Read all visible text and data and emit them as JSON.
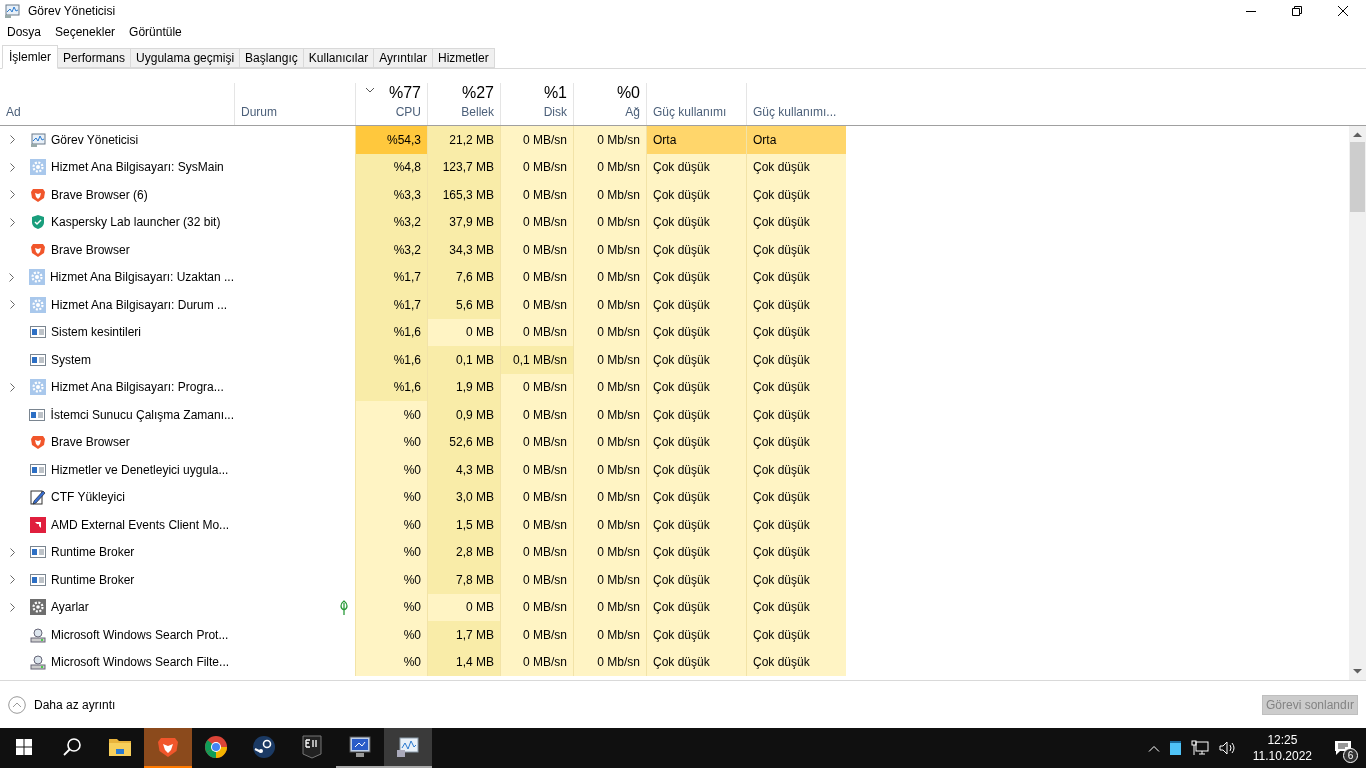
{
  "window": {
    "title": "Görev Yöneticisi"
  },
  "menu": [
    "Dosya",
    "Seçenekler",
    "Görüntüle"
  ],
  "tabs": [
    {
      "label": "İşlemler",
      "selected": true
    },
    {
      "label": "Performans",
      "selected": false
    },
    {
      "label": "Uygulama geçmişi",
      "selected": false
    },
    {
      "label": "Başlangıç",
      "selected": false
    },
    {
      "label": "Kullanıcılar",
      "selected": false
    },
    {
      "label": "Ayrıntılar",
      "selected": false
    },
    {
      "label": "Hizmetler",
      "selected": false
    }
  ],
  "columns": [
    {
      "label": "Ad",
      "sorted": false
    },
    {
      "label": "Durum",
      "sorted": false
    },
    {
      "label": "CPU",
      "total": "%77",
      "sorted": true
    },
    {
      "label": "Bellek",
      "total": "%27",
      "sorted": false
    },
    {
      "label": "Disk",
      "total": "%1",
      "sorted": false
    },
    {
      "label": "Ağ",
      "total": "%0",
      "sorted": false
    },
    {
      "label": "Güç kullanımı",
      "sorted": false
    },
    {
      "label": "Güç kullanımı...",
      "sorted": false
    }
  ],
  "rows": [
    {
      "name": "Görev Yöneticisi",
      "kind": "taskmgr",
      "expandable": true,
      "eco": false,
      "cells": [
        {
          "value": "%54,3",
          "color": "#ffc83d"
        },
        {
          "value": "21,2 MB",
          "color": "#f9eca8"
        },
        {
          "value": "0 MB/sn",
          "color": "#fff4c4"
        },
        {
          "value": "0 Mb/sn",
          "color": "#fff4c4"
        },
        {
          "value": "Orta",
          "color": "#ffd66b"
        },
        {
          "value": "Orta",
          "color": "#ffd66b"
        }
      ]
    },
    {
      "name": "Hizmet Ana Bilgisayarı: SysMain",
      "kind": "service",
      "expandable": true,
      "eco": false,
      "cells": [
        {
          "value": "%4,8",
          "color": "#f9eca8"
        },
        {
          "value": "123,7 MB",
          "color": "#f9eca8"
        },
        {
          "value": "0 MB/sn",
          "color": "#fff4c4"
        },
        {
          "value": "0 Mb/sn",
          "color": "#fff4c4"
        },
        {
          "value": "Çok düşük",
          "color": "#fff4c4"
        },
        {
          "value": "Çok düşük",
          "color": "#fff4c4"
        }
      ]
    },
    {
      "name": "Brave Browser (6)",
      "kind": "brave",
      "expandable": true,
      "eco": false,
      "cells": [
        {
          "value": "%3,3",
          "color": "#f9eca8"
        },
        {
          "value": "165,3 MB",
          "color": "#f9eca8"
        },
        {
          "value": "0 MB/sn",
          "color": "#fff4c4"
        },
        {
          "value": "0 Mb/sn",
          "color": "#fff4c4"
        },
        {
          "value": "Çok düşük",
          "color": "#fff4c4"
        },
        {
          "value": "Çok düşük",
          "color": "#fff4c4"
        }
      ]
    },
    {
      "name": "Kaspersky Lab launcher (32 bit)",
      "kind": "shield",
      "expandable": true,
      "eco": false,
      "cells": [
        {
          "value": "%3,2",
          "color": "#f9eca8"
        },
        {
          "value": "37,9 MB",
          "color": "#f9eca8"
        },
        {
          "value": "0 MB/sn",
          "color": "#fff4c4"
        },
        {
          "value": "0 Mb/sn",
          "color": "#fff4c4"
        },
        {
          "value": "Çok düşük",
          "color": "#fff4c4"
        },
        {
          "value": "Çok düşük",
          "color": "#fff4c4"
        }
      ]
    },
    {
      "name": "Brave Browser",
      "kind": "brave",
      "expandable": false,
      "eco": false,
      "cells": [
        {
          "value": "%3,2",
          "color": "#f9eca8"
        },
        {
          "value": "34,3 MB",
          "color": "#f9eca8"
        },
        {
          "value": "0 MB/sn",
          "color": "#fff4c4"
        },
        {
          "value": "0 Mb/sn",
          "color": "#fff4c4"
        },
        {
          "value": "Çok düşük",
          "color": "#fff4c4"
        },
        {
          "value": "Çok düşük",
          "color": "#fff4c4"
        }
      ]
    },
    {
      "name": "Hizmet Ana Bilgisayarı: Uzaktan ...",
      "kind": "service",
      "expandable": true,
      "eco": false,
      "cells": [
        {
          "value": "%1,7",
          "color": "#f9eca8"
        },
        {
          "value": "7,6 MB",
          "color": "#f9eca8"
        },
        {
          "value": "0 MB/sn",
          "color": "#fff4c4"
        },
        {
          "value": "0 Mb/sn",
          "color": "#fff4c4"
        },
        {
          "value": "Çok düşük",
          "color": "#fff4c4"
        },
        {
          "value": "Çok düşük",
          "color": "#fff4c4"
        }
      ]
    },
    {
      "name": "Hizmet Ana Bilgisayarı: Durum ...",
      "kind": "service",
      "expandable": true,
      "eco": false,
      "cells": [
        {
          "value": "%1,7",
          "color": "#f9eca8"
        },
        {
          "value": "5,6 MB",
          "color": "#f9eca8"
        },
        {
          "value": "0 MB/sn",
          "color": "#fff4c4"
        },
        {
          "value": "0 Mb/sn",
          "color": "#fff4c4"
        },
        {
          "value": "Çok düşük",
          "color": "#fff4c4"
        },
        {
          "value": "Çok düşük",
          "color": "#fff4c4"
        }
      ]
    },
    {
      "name": "Sistem kesintileri",
      "kind": "window",
      "expandable": false,
      "eco": false,
      "cells": [
        {
          "value": "%1,6",
          "color": "#f9eca8"
        },
        {
          "value": "0 MB",
          "color": "#fff4c4"
        },
        {
          "value": "0 MB/sn",
          "color": "#fff4c4"
        },
        {
          "value": "0 Mb/sn",
          "color": "#fff4c4"
        },
        {
          "value": "Çok düşük",
          "color": "#fff4c4"
        },
        {
          "value": "Çok düşük",
          "color": "#fff4c4"
        }
      ]
    },
    {
      "name": "System",
      "kind": "window",
      "expandable": false,
      "eco": false,
      "cells": [
        {
          "value": "%1,6",
          "color": "#f9eca8"
        },
        {
          "value": "0,1 MB",
          "color": "#f9eca8"
        },
        {
          "value": "0,1 MB/sn",
          "color": "#f9eca8"
        },
        {
          "value": "0 Mb/sn",
          "color": "#fff4c4"
        },
        {
          "value": "Çok düşük",
          "color": "#fff4c4"
        },
        {
          "value": "Çok düşük",
          "color": "#fff4c4"
        }
      ]
    },
    {
      "name": "Hizmet Ana Bilgisayarı: Progra...",
      "kind": "service",
      "expandable": true,
      "eco": false,
      "cells": [
        {
          "value": "%1,6",
          "color": "#f9eca8"
        },
        {
          "value": "1,9 MB",
          "color": "#f9eca8"
        },
        {
          "value": "0 MB/sn",
          "color": "#fff4c4"
        },
        {
          "value": "0 Mb/sn",
          "color": "#fff4c4"
        },
        {
          "value": "Çok düşük",
          "color": "#fff4c4"
        },
        {
          "value": "Çok düşük",
          "color": "#fff4c4"
        }
      ]
    },
    {
      "name": "İstemci Sunucu Çalışma Zamanı...",
      "kind": "window",
      "expandable": false,
      "eco": false,
      "cells": [
        {
          "value": "%0",
          "color": "#fff4c4"
        },
        {
          "value": "0,9 MB",
          "color": "#f9eca8"
        },
        {
          "value": "0 MB/sn",
          "color": "#fff4c4"
        },
        {
          "value": "0 Mb/sn",
          "color": "#fff4c4"
        },
        {
          "value": "Çok düşük",
          "color": "#fff4c4"
        },
        {
          "value": "Çok düşük",
          "color": "#fff4c4"
        }
      ]
    },
    {
      "name": "Brave Browser",
      "kind": "brave",
      "expandable": false,
      "eco": false,
      "cells": [
        {
          "value": "%0",
          "color": "#fff4c4"
        },
        {
          "value": "52,6 MB",
          "color": "#f9eca8"
        },
        {
          "value": "0 MB/sn",
          "color": "#fff4c4"
        },
        {
          "value": "0 Mb/sn",
          "color": "#fff4c4"
        },
        {
          "value": "Çok düşük",
          "color": "#fff4c4"
        },
        {
          "value": "Çok düşük",
          "color": "#fff4c4"
        }
      ]
    },
    {
      "name": "Hizmetler ve Denetleyici uygula...",
      "kind": "window",
      "expandable": false,
      "eco": false,
      "cells": [
        {
          "value": "%0",
          "color": "#fff4c4"
        },
        {
          "value": "4,3 MB",
          "color": "#f9eca8"
        },
        {
          "value": "0 MB/sn",
          "color": "#fff4c4"
        },
        {
          "value": "0 Mb/sn",
          "color": "#fff4c4"
        },
        {
          "value": "Çok düşük",
          "color": "#fff4c4"
        },
        {
          "value": "Çok düşük",
          "color": "#fff4c4"
        }
      ]
    },
    {
      "name": "CTF Yükleyici",
      "kind": "ctf",
      "expandable": false,
      "eco": false,
      "cells": [
        {
          "value": "%0",
          "color": "#fff4c4"
        },
        {
          "value": "3,0 MB",
          "color": "#f9eca8"
        },
        {
          "value": "0 MB/sn",
          "color": "#fff4c4"
        },
        {
          "value": "0 Mb/sn",
          "color": "#fff4c4"
        },
        {
          "value": "Çok düşük",
          "color": "#fff4c4"
        },
        {
          "value": "Çok düşük",
          "color": "#fff4c4"
        }
      ]
    },
    {
      "name": "AMD External Events Client Mo...",
      "kind": "amd",
      "expandable": false,
      "eco": false,
      "cells": [
        {
          "value": "%0",
          "color": "#fff4c4"
        },
        {
          "value": "1,5 MB",
          "color": "#f9eca8"
        },
        {
          "value": "0 MB/sn",
          "color": "#fff4c4"
        },
        {
          "value": "0 Mb/sn",
          "color": "#fff4c4"
        },
        {
          "value": "Çok düşük",
          "color": "#fff4c4"
        },
        {
          "value": "Çok düşük",
          "color": "#fff4c4"
        }
      ]
    },
    {
      "name": "Runtime Broker",
      "kind": "window",
      "expandable": true,
      "eco": false,
      "cells": [
        {
          "value": "%0",
          "color": "#fff4c4"
        },
        {
          "value": "2,8 MB",
          "color": "#f9eca8"
        },
        {
          "value": "0 MB/sn",
          "color": "#fff4c4"
        },
        {
          "value": "0 Mb/sn",
          "color": "#fff4c4"
        },
        {
          "value": "Çok düşük",
          "color": "#fff4c4"
        },
        {
          "value": "Çok düşük",
          "color": "#fff4c4"
        }
      ]
    },
    {
      "name": "Runtime Broker",
      "kind": "window",
      "expandable": true,
      "eco": false,
      "cells": [
        {
          "value": "%0",
          "color": "#fff4c4"
        },
        {
          "value": "7,8 MB",
          "color": "#f9eca8"
        },
        {
          "value": "0 MB/sn",
          "color": "#fff4c4"
        },
        {
          "value": "0 Mb/sn",
          "color": "#fff4c4"
        },
        {
          "value": "Çok düşük",
          "color": "#fff4c4"
        },
        {
          "value": "Çok düşük",
          "color": "#fff4c4"
        }
      ]
    },
    {
      "name": "Ayarlar",
      "kind": "gear",
      "expandable": true,
      "eco": true,
      "cells": [
        {
          "value": "%0",
          "color": "#fff4c4"
        },
        {
          "value": "0 MB",
          "color": "#fff4c4"
        },
        {
          "value": "0 MB/sn",
          "color": "#fff4c4"
        },
        {
          "value": "0 Mb/sn",
          "color": "#fff4c4"
        },
        {
          "value": "Çok düşük",
          "color": "#fff4c4"
        },
        {
          "value": "Çok düşük",
          "color": "#fff4c4"
        }
      ]
    },
    {
      "name": "Microsoft Windows Search Prot...",
      "kind": "search",
      "expandable": false,
      "eco": false,
      "cells": [
        {
          "value": "%0",
          "color": "#fff4c4"
        },
        {
          "value": "1,7 MB",
          "color": "#f9eca8"
        },
        {
          "value": "0 MB/sn",
          "color": "#fff4c4"
        },
        {
          "value": "0 Mb/sn",
          "color": "#fff4c4"
        },
        {
          "value": "Çok düşük",
          "color": "#fff4c4"
        },
        {
          "value": "Çok düşük",
          "color": "#fff4c4"
        }
      ]
    },
    {
      "name": "Microsoft Windows Search Filte...",
      "kind": "search",
      "expandable": false,
      "eco": false,
      "cells": [
        {
          "value": "%0",
          "color": "#fff4c4"
        },
        {
          "value": "1,4 MB",
          "color": "#f9eca8"
        },
        {
          "value": "0 MB/sn",
          "color": "#fff4c4"
        },
        {
          "value": "0 Mb/sn",
          "color": "#fff4c4"
        },
        {
          "value": "Çok düşük",
          "color": "#fff4c4"
        },
        {
          "value": "Çok düşük",
          "color": "#fff4c4"
        }
      ]
    }
  ],
  "footer": {
    "toggle": "Daha az ayrıntı",
    "end_task": {
      "label": "Görevi sonlandır",
      "disabled": true
    }
  },
  "taskbar": {
    "items": [
      {
        "kind": "start",
        "running": false,
        "flashing": false,
        "focused": false
      },
      {
        "kind": "search",
        "running": false,
        "flashing": false,
        "focused": false
      },
      {
        "kind": "folder",
        "running": false,
        "flashing": false,
        "focused": false
      },
      {
        "kind": "brave",
        "running": true,
        "flashing": true,
        "focused": false
      },
      {
        "kind": "chrome",
        "running": false,
        "flashing": false,
        "focused": false
      },
      {
        "kind": "steam",
        "running": false,
        "flashing": false,
        "focused": false
      },
      {
        "kind": "epic",
        "running": false,
        "flashing": false,
        "focused": false
      },
      {
        "kind": "monitor",
        "running": true,
        "flashing": false,
        "focused": false
      },
      {
        "kind": "taskmgr",
        "running": true,
        "flashing": false,
        "focused": true
      }
    ],
    "time": "12:25",
    "date": "11.10.2022",
    "notifications": "6"
  }
}
